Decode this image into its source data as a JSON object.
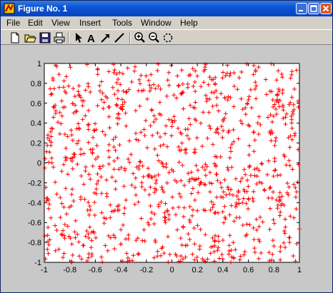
{
  "window": {
    "title": "Figure No. 1",
    "accent": "#0a55d8"
  },
  "menubar": {
    "items": [
      {
        "label": "File"
      },
      {
        "label": "Edit"
      },
      {
        "label": "View"
      },
      {
        "label": "Insert"
      },
      {
        "label": "Tools"
      },
      {
        "label": "Window"
      },
      {
        "label": "Help"
      }
    ]
  },
  "toolbar": {
    "icons": [
      "new-figure-icon",
      "open-file-icon",
      "save-icon",
      "print-icon",
      "select-arrow-icon",
      "insert-text-icon",
      "insert-arrow-icon",
      "insert-line-icon",
      "zoom-in-icon",
      "zoom-out-icon",
      "rotate-icon"
    ]
  },
  "chart_data": {
    "type": "scatter",
    "marker": "+",
    "color": "#ff0000",
    "xlim": [
      -1,
      1
    ],
    "ylim": [
      -1,
      1
    ],
    "x_ticks": [
      "-1",
      "-0.8",
      "-0.6",
      "-0.4",
      "-0.2",
      "0",
      "0.2",
      "0.4",
      "0.6",
      "0.8",
      "1"
    ],
    "y_ticks": [
      "1",
      "0.8",
      "0.6",
      "0.4",
      "0.2",
      "0",
      "-0.2",
      "-0.4",
      "-0.6",
      "-0.8",
      "-1"
    ],
    "grid": false,
    "n_points": 1000,
    "distribution": "uniform random points in [-1,1] x [-1,1]"
  }
}
